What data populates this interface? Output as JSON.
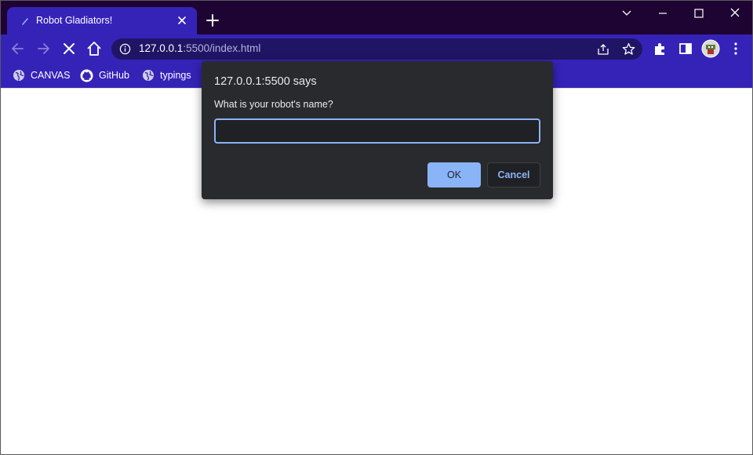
{
  "browser": {
    "tab": {
      "title": "Robot Gladiators!"
    },
    "address_bar": {
      "url_host": "127.0.0.1",
      "url_rest": ":5500/index.html"
    },
    "bookmarks": [
      {
        "label": "CANVAS",
        "icon": "globe-icon"
      },
      {
        "label": "GitHub",
        "icon": "github-icon"
      },
      {
        "label": "typings",
        "icon": "globe-icon"
      }
    ],
    "colors": {
      "frame": "#1e0433",
      "toolbar": "#3523b8",
      "omnibox": "#201565"
    }
  },
  "dialog": {
    "title": "127.0.0.1:5500 says",
    "message": "What is your robot's name?",
    "input_value": "",
    "ok_label": "OK",
    "cancel_label": "Cancel",
    "accent": "#8ab4f8"
  }
}
